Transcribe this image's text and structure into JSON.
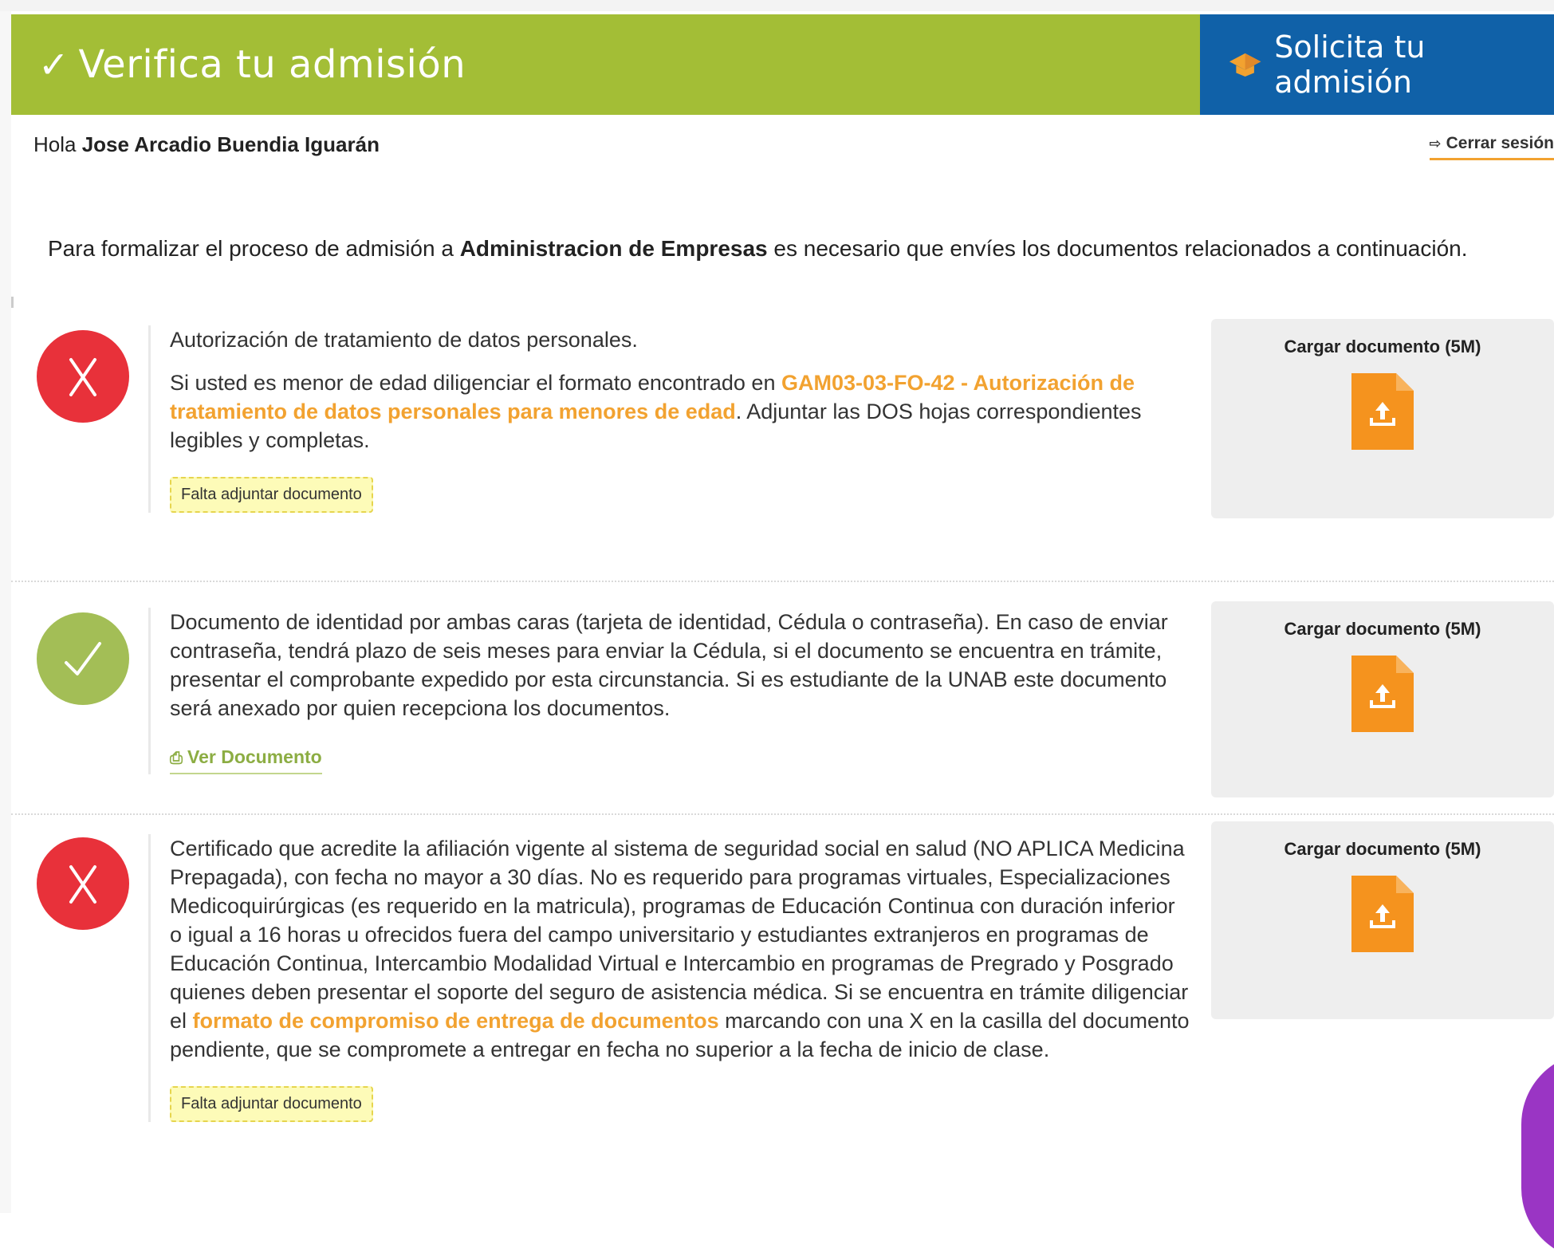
{
  "header": {
    "title": "Verifica tu admisión",
    "request_label": "Solicita tu admisión",
    "colors": {
      "green": "#a3be36",
      "blue": "#1061a8"
    }
  },
  "user": {
    "greeting": "Hola",
    "name": "Jose Arcadio Buendia Iguarán",
    "logout_label": "Cerrar sesión"
  },
  "intro": {
    "prefix": "Para formalizar el proceso de admisión a",
    "program": "Administracion de Empresas",
    "suffix": "es necesario que envíes los documentos relacionados a continuación."
  },
  "documents": [
    {
      "status": "missing",
      "status_icon": "x-icon",
      "paragraph1": "Autorización de tratamiento de datos personales.",
      "paragraph2_prefix": "Si usted es menor de edad diligenciar el formato encontrado en",
      "paragraph2_link": "GAM03-03-FO-42 - Autorización de tratamiento de datos personales para menores de edad",
      "paragraph2_suffix": ". Adjuntar las DOS hojas correspondientes legibles y completas.",
      "badge": "Falta adjuntar documento",
      "upload_label": "Cargar documento (5M)"
    },
    {
      "status": "ok",
      "status_icon": "check-icon",
      "paragraph1": "Documento de identidad por ambas caras (tarjeta de identidad, Cédula o contraseña). En caso de enviar contraseña, tendrá plazo de seis meses para enviar la Cédula, si el documento se encuentra en trámite, presentar el comprobante expedido por esta circunstancia. Si es estudiante de la UNAB este documento será anexado por quien recepciona los documentos.",
      "view_label": "Ver Documento",
      "upload_label": "Cargar documento (5M)"
    },
    {
      "status": "missing",
      "status_icon": "x-icon",
      "paragraph1_prefix": "Certificado que acredite la afiliación vigente al sistema de seguridad social en salud (NO APLICA Medicina Prepagada), con fecha no mayor a 30 días. No es requerido para programas virtuales, Especializaciones Medicoquirúrgicas (es requerido en la matricula), programas de Educación Continua con duración inferior o igual a 16 horas u ofrecidos fuera del campo universitario y estudiantes extranjeros en programas de Educación Continua, Intercambio Modalidad Virtual e Intercambio en programas de Pregrado y Posgrado quienes deben presentar el soporte del seguro de asistencia médica. Si se encuentra en trámite diligenciar el",
      "paragraph1_link": "formato de compromiso de entrega de documentos",
      "paragraph1_suffix": "marcando con una X en la casilla del documento pendiente, que se compromete a entregar en fecha no superior a la fecha de inicio de clase.",
      "badge": "Falta adjuntar documento",
      "upload_label": "Cargar documento (5M)"
    }
  ]
}
